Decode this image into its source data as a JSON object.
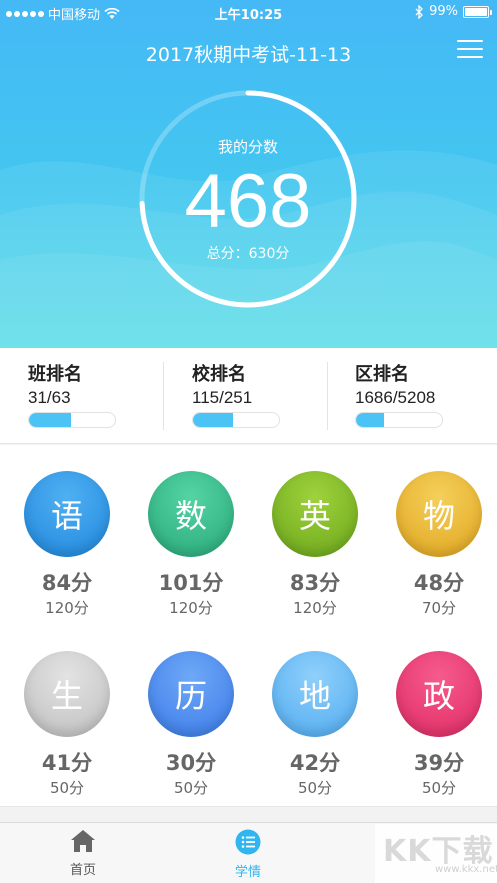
{
  "status_bar": {
    "carrier": "中国移动",
    "time": "上午10:25",
    "battery": "99%"
  },
  "header": {
    "title": "2017秋期中考试-11-13"
  },
  "score": {
    "label": "我的分数",
    "value": "468",
    "total": "总分：630分",
    "fraction": 0.743
  },
  "ranks": [
    {
      "label": "班排名",
      "value": "31/63",
      "fraction": 0.49
    },
    {
      "label": "校排名",
      "value": "115/251",
      "fraction": 0.46
    },
    {
      "label": "区排名",
      "value": "1686/5208",
      "fraction": 0.32
    }
  ],
  "subjects": [
    {
      "name": "语",
      "score": "84分",
      "full": "120分",
      "color_top": "#4fb0f2",
      "color_bottom": "#1f86dc"
    },
    {
      "name": "数",
      "score": "101分",
      "full": "120分",
      "color_top": "#54d3a3",
      "color_bottom": "#28a979"
    },
    {
      "name": "英",
      "score": "83分",
      "full": "120分",
      "color_top": "#9fd23c",
      "color_bottom": "#6aa51a"
    },
    {
      "name": "物",
      "score": "48分",
      "full": "70分",
      "color_top": "#f5cf5a",
      "color_bottom": "#e0a51e"
    },
    {
      "name": "生",
      "score": "41分",
      "full": "50分",
      "color_top": "#e3e3e3",
      "color_bottom": "#bdbdbd"
    },
    {
      "name": "历",
      "score": "30分",
      "full": "50分",
      "color_top": "#6ea8f7",
      "color_bottom": "#3a7ae8"
    },
    {
      "name": "地",
      "score": "42分",
      "full": "50分",
      "color_top": "#8fd0fb",
      "color_bottom": "#4faaf0"
    },
    {
      "name": "政",
      "score": "39分",
      "full": "50分",
      "color_top": "#f65b8e",
      "color_bottom": "#de2a62"
    }
  ],
  "tabbar": {
    "home_label": "首页",
    "study_label": "学情",
    "active_color": "#2fb5f0",
    "inactive_color": "#555555"
  },
  "watermark": {
    "text": "KK下载",
    "sub": "www.kkx.net"
  }
}
